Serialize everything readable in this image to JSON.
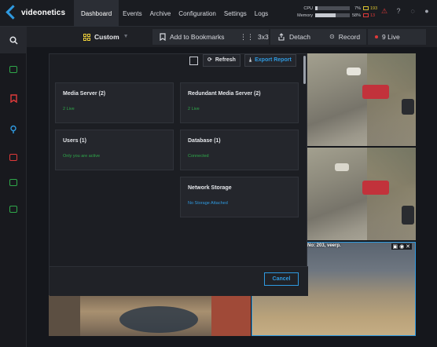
{
  "app": {
    "logo": "videonetics"
  },
  "nav": {
    "items": [
      {
        "label": "Dashboard",
        "active": true
      },
      {
        "label": "Events",
        "active": false
      },
      {
        "label": "Archive",
        "active": false
      },
      {
        "label": "Configuration",
        "active": false
      },
      {
        "label": "Settings",
        "active": false
      },
      {
        "label": "Logs",
        "active": false
      }
    ]
  },
  "stats": {
    "cpu_label": "CPU",
    "cpu_pct": "7%",
    "cpu_value": 0.07,
    "memory_label": "Memory",
    "memory_pct": "58%",
    "memory_value": 0.58,
    "yellow_count": "193",
    "red_count": "13",
    "yellow_color": "#d9c230",
    "red_color": "#e03a3a"
  },
  "toolbar": {
    "layout_label": "Custom",
    "bookmark_label": "Add to Bookmarks",
    "grid_label": "3x3",
    "detach_label": "Detach",
    "record_label": "Record",
    "live_label": "9 Live"
  },
  "sidebar": {
    "icons": [
      {
        "name": "search-icon",
        "color": "#e0e2e6"
      },
      {
        "name": "monitor-icon",
        "color": "#2fa84a"
      },
      {
        "name": "bookmark-icon",
        "color": "#e03a3a"
      },
      {
        "name": "location-icon",
        "color": "#2f9ae0"
      },
      {
        "name": "record-icon",
        "color": "#e03a3a"
      },
      {
        "name": "display-icon",
        "color": "#2fa84a"
      },
      {
        "name": "screen-icon",
        "color": "#2fa84a"
      }
    ]
  },
  "cameras": {
    "feed_label": "No: 203, veerp."
  },
  "modal": {
    "refresh_label": "Refresh",
    "export_label": "Export Report",
    "cards": [
      {
        "title": "Media Server (2)",
        "status": "2 Live",
        "status_color": "green"
      },
      {
        "title": "Redundant Media Server (2)",
        "status": "2 Live",
        "status_color": "green"
      },
      {
        "title": "Users (1)",
        "status": "Only you are active",
        "status_color": "green"
      },
      {
        "title": "Database (1)",
        "status": "Connected",
        "status_color": "green"
      },
      {
        "title": "Network Storage",
        "status": "No Storage Attached",
        "status_color": "blue"
      }
    ],
    "cancel_label": "Cancel"
  },
  "colors": {
    "accent_blue": "#2f9ae0",
    "accent_yellow": "#f0d23a",
    "status_green": "#2fa84a"
  }
}
